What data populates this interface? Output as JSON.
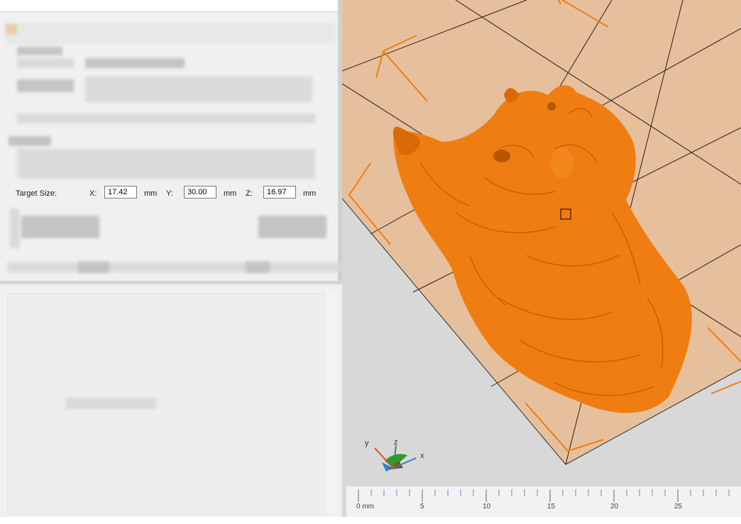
{
  "target_size": {
    "label": "Target Size:",
    "x_label": "X:",
    "x_value": "17.42",
    "y_label": "Y:",
    "y_value": "30.00",
    "z_label": "Z:",
    "z_value": "16.97",
    "unit": "mm"
  },
  "axis_triad": {
    "x": "x",
    "y": "y",
    "z": "z"
  },
  "ruler": {
    "labels": [
      "0 mm",
      "5",
      "10",
      "15",
      "20",
      "25"
    ]
  },
  "colors": {
    "model": "#f07d12",
    "bed": "#e8c4a1",
    "accent": "#f07d12"
  }
}
